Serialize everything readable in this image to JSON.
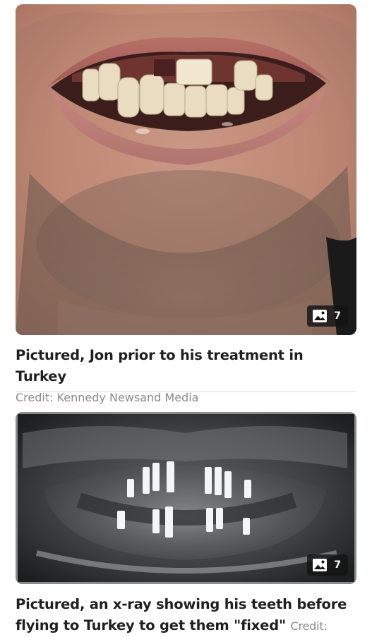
{
  "articles": [
    {
      "gallery_count": "7",
      "caption": "Pictured, Jon prior to his treatment in Turkey",
      "credit": "Credit: Kennedy Newsand Media",
      "image_alt": "man with missing teeth"
    },
    {
      "gallery_count": "7",
      "caption": "Pictured, an x-ray showing his teeth before flying to Turkey to get them \"fixed\"",
      "credit": "Credit:",
      "image_alt": "dental x-ray with implants"
    }
  ],
  "icons": {
    "gallery": "image-gallery-icon"
  },
  "colors": {
    "caption": "#1f1f1f",
    "credit": "#8a8a8a",
    "badge_bg": "#141414",
    "divider": "#dcdcdc"
  }
}
